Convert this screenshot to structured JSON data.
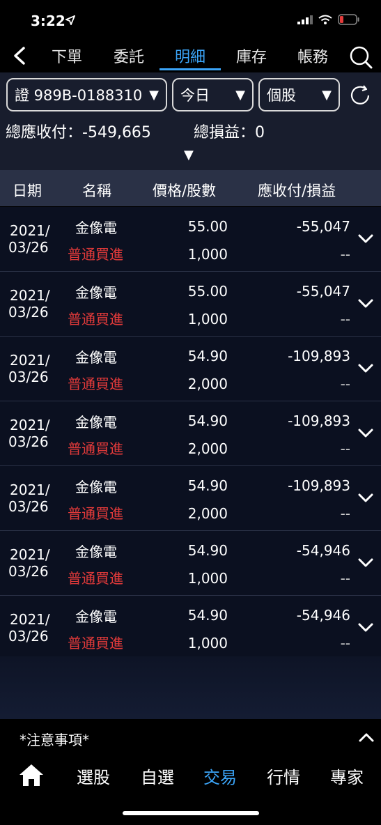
{
  "status": {
    "time": "3:22"
  },
  "nav": {
    "tabs": [
      "下單",
      "委託",
      "明細",
      "庫存",
      "帳務"
    ],
    "active_index": 2
  },
  "filters": {
    "account": "證 989B-0188310",
    "period": "今日",
    "scope": "個股"
  },
  "summary": {
    "receivable_label": "總應收付：",
    "receivable_value": "-549,665",
    "pnl_label": "總損益：",
    "pnl_value": "0"
  },
  "table": {
    "headers": [
      "日期",
      "名稱",
      "價格/股數",
      "應收付/損益"
    ],
    "rows": [
      {
        "date1": "2021/",
        "date2": "03/26",
        "name": "金像電",
        "order_type": "普通買進",
        "price": "55.00",
        "qty": "1,000",
        "amount": "-55,047",
        "pnl": "--"
      },
      {
        "date1": "2021/",
        "date2": "03/26",
        "name": "金像電",
        "order_type": "普通買進",
        "price": "55.00",
        "qty": "1,000",
        "amount": "-55,047",
        "pnl": "--"
      },
      {
        "date1": "2021/",
        "date2": "03/26",
        "name": "金像電",
        "order_type": "普通買進",
        "price": "54.90",
        "qty": "2,000",
        "amount": "-109,893",
        "pnl": "--"
      },
      {
        "date1": "2021/",
        "date2": "03/26",
        "name": "金像電",
        "order_type": "普通買進",
        "price": "54.90",
        "qty": "2,000",
        "amount": "-109,893",
        "pnl": "--"
      },
      {
        "date1": "2021/",
        "date2": "03/26",
        "name": "金像電",
        "order_type": "普通買進",
        "price": "54.90",
        "qty": "2,000",
        "amount": "-109,893",
        "pnl": "--"
      },
      {
        "date1": "2021/",
        "date2": "03/26",
        "name": "金像電",
        "order_type": "普通買進",
        "price": "54.90",
        "qty": "1,000",
        "amount": "-54,946",
        "pnl": "--"
      },
      {
        "date1": "2021/",
        "date2": "03/26",
        "name": "金像電",
        "order_type": "普通買進",
        "price": "54.90",
        "qty": "1,000",
        "amount": "-54,946",
        "pnl": "--"
      }
    ]
  },
  "notice": {
    "label": "*注意事項*"
  },
  "tabbar": {
    "items": [
      "選股",
      "自選",
      "交易",
      "行情",
      "專家"
    ],
    "active_index": 2
  },
  "colors": {
    "accent": "#3ba4f7",
    "buy": "#e33a3a"
  }
}
